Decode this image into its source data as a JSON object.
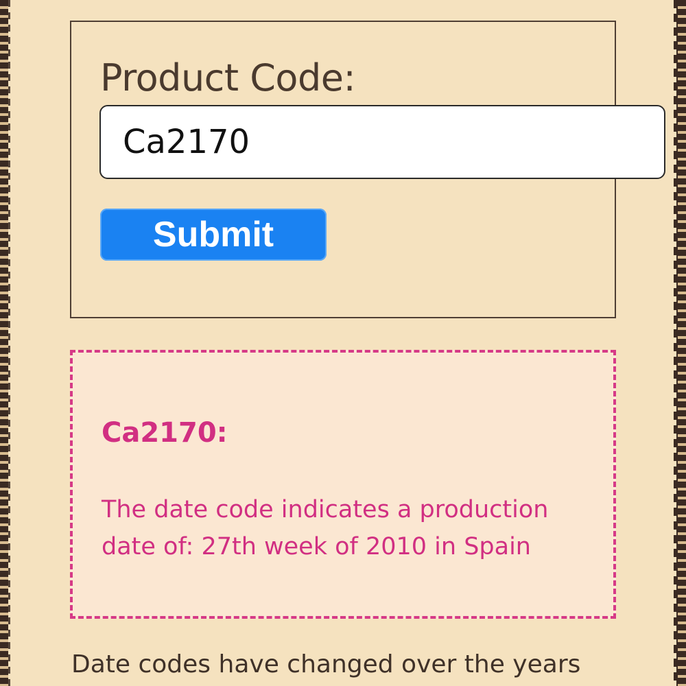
{
  "form": {
    "label": "Product Code:",
    "input_value": "Ca2170",
    "submit_label": "Submit"
  },
  "result": {
    "title": "Ca2170:",
    "line1": "The date code indicates a production",
    "line2": "date of: 27th week of 2010 in Spain"
  },
  "footer": {
    "text": "Date codes have changed over the years"
  },
  "colors": {
    "background": "#f5e2bf",
    "accent": "#1a82f2",
    "result_text": "#d12f82",
    "result_border": "#d63a87",
    "result_bg": "#fbe7d2"
  }
}
